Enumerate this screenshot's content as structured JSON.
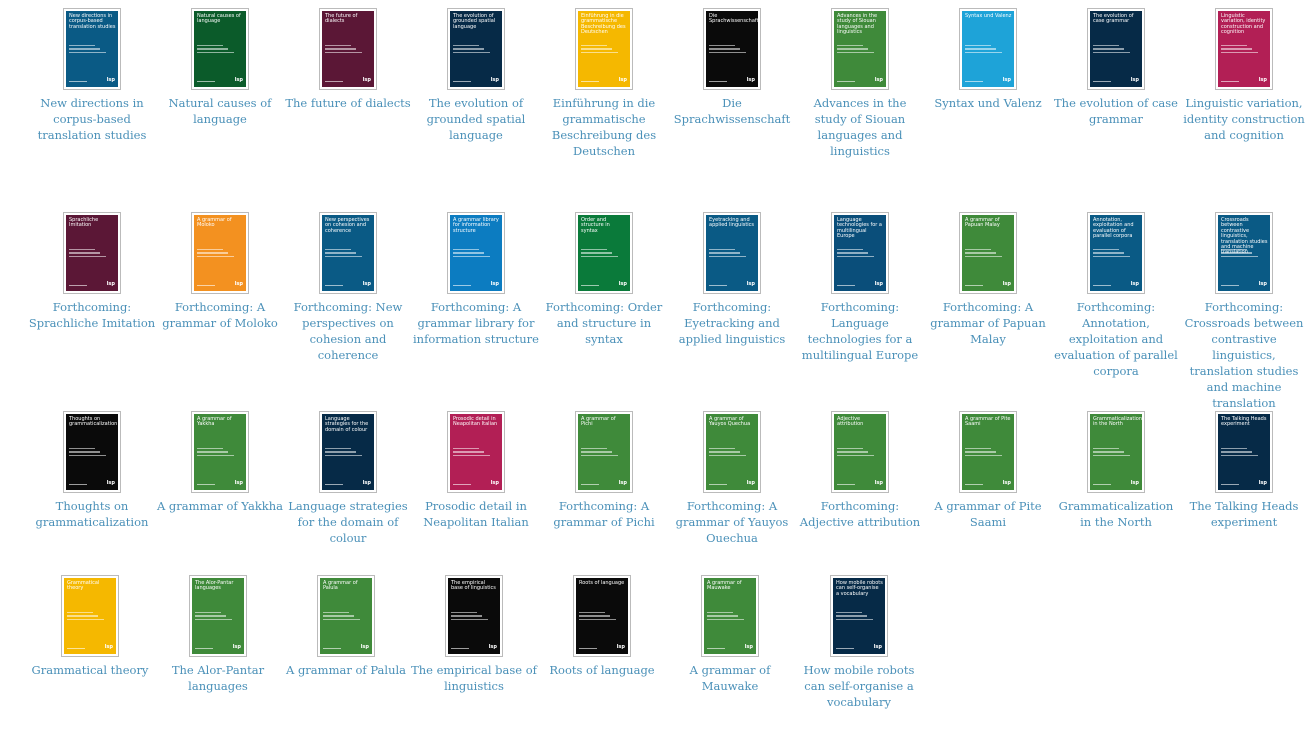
{
  "books": [
    {
      "caption": "New directions in corpus-based translation studies",
      "cover_title": "New directions in corpus-based translation studies",
      "color": "#0a5a85"
    },
    {
      "caption": "Natural causes of language",
      "cover_title": "Natural causes of language",
      "color": "#0b5b2a"
    },
    {
      "caption": "The future of dialects",
      "cover_title": "The future of dialects",
      "color": "#5b1736"
    },
    {
      "caption": "The evolution of grounded spatial language",
      "cover_title": "The evolution of grounded spatial language",
      "color": "#062a47"
    },
    {
      "caption": "Einführung in die grammatische Beschreibung des Deutschen",
      "cover_title": "Einführung in die grammatische Beschreibung des Deutschen",
      "color": "#f5b800"
    },
    {
      "caption": "Die Sprachwissenschaft",
      "cover_title": "Die Sprachwissenschaft",
      "color": "#0a0a0a"
    },
    {
      "caption": "Advances in the study of Siouan languages and linguistics",
      "cover_title": "Advances in the study of Siouan languages and linguistics",
      "color": "#3f8a3a"
    },
    {
      "caption": "Syntax und Valenz",
      "cover_title": "Syntax und Valenz",
      "color": "#1ea3d8"
    },
    {
      "caption": "The evolution of case grammar",
      "cover_title": "The evolution of case grammar",
      "color": "#062a47"
    },
    {
      "caption": "Linguistic variation, identity construction and cognition",
      "cover_title": "Linguistic variation, identity construction and cognition",
      "color": "#b21f55"
    },
    {
      "caption": "Forthcoming: Sprachliche Imitation",
      "cover_title": "Sprachliche Imitation",
      "color": "#5b1736"
    },
    {
      "caption": "Forthcoming: A grammar of Moloko",
      "cover_title": "A grammar of Moloko",
      "color": "#f39120"
    },
    {
      "caption": "Forthcoming: New perspectives on cohesion and coherence",
      "cover_title": "New perspectives on cohesion and coherence",
      "color": "#0a5a85"
    },
    {
      "caption": "Forthcoming: A grammar library for information structure",
      "cover_title": "A grammar library for information structure",
      "color": "#0c7cc1"
    },
    {
      "caption": "Forthcoming: Order and structure in syntax",
      "cover_title": "Order and structure in syntax",
      "color": "#0a7a3a"
    },
    {
      "caption": "Forthcoming: Eyetracking and applied linguistics",
      "cover_title": "Eyetracking and applied linguistics",
      "color": "#0a5a85"
    },
    {
      "caption": "Forthcoming: Language technologies for a multilingual Europe",
      "cover_title": "Language technologies for a multilingual Europe",
      "color": "#0a4e7a"
    },
    {
      "caption": "Forthcoming: A grammar of Papuan Malay",
      "cover_title": "A grammar of Papuan Malay",
      "color": "#3f8a3a"
    },
    {
      "caption": "Forthcoming: Annotation, exploitation and evaluation of parallel corpora",
      "cover_title": "Annotation, exploitation and evaluation of parallel corpora",
      "color": "#0a5a85"
    },
    {
      "caption": "Forthcoming: Crossroads between contrastive linguistics, translation studies and machine translation",
      "cover_title": "Crossroads between contrastive linguistics, translation studies and machine translation",
      "color": "#0a5a85"
    },
    {
      "caption": "Thoughts on grammaticalization",
      "cover_title": "Thoughts on grammaticalization",
      "color": "#0a0a0a"
    },
    {
      "caption": "A grammar of Yakkha",
      "cover_title": "A grammar of Yakkha",
      "color": "#3f8a3a"
    },
    {
      "caption": "Language strategies for the domain of colour",
      "cover_title": "Language strategies for the domain of colour",
      "color": "#062a47"
    },
    {
      "caption": "Prosodic detail in Neapolitan Italian",
      "cover_title": "Prosodic detail in Neapolitan Italian",
      "color": "#b21f55"
    },
    {
      "caption": "Forthcoming: A grammar of Pichi",
      "cover_title": "A grammar of Pichi",
      "color": "#3f8a3a"
    },
    {
      "caption": "Forthcoming: A grammar of Yauyos Ouechua",
      "cover_title": "A grammar of Yauyos Quechua",
      "color": "#3f8a3a"
    },
    {
      "caption": "Forthcoming: Adjective attribution",
      "cover_title": "Adjective attribution",
      "color": "#3f8a3a"
    },
    {
      "caption": "A grammar of Pite Saami",
      "cover_title": "A grammar of Pite Saami",
      "color": "#3f8a3a"
    },
    {
      "caption": "Grammaticalization in the North",
      "cover_title": "Grammaticalization in the North",
      "color": "#3f8a3a"
    },
    {
      "caption": "The Talking Heads experiment",
      "cover_title": "The Talking Heads experiment",
      "color": "#062a47"
    },
    {
      "caption": "Grammatical theory",
      "cover_title": "Grammatical theory",
      "color": "#f5b800"
    },
    {
      "caption": "The Alor-Pantar languages",
      "cover_title": "The Alor-Pantar languages",
      "color": "#3f8a3a"
    },
    {
      "caption": "A grammar of Palula",
      "cover_title": "A grammar of Palula",
      "color": "#3f8a3a"
    },
    {
      "caption": "The empirical base of linguistics",
      "cover_title": "The empirical base of linguistics",
      "color": "#0a0a0a"
    },
    {
      "caption": "Roots of language",
      "cover_title": "Roots of language",
      "color": "#0a0a0a"
    },
    {
      "caption": "A grammar of Mauwake",
      "cover_title": "A grammar of Mauwake",
      "color": "#3f8a3a"
    },
    {
      "caption": "How mobile robots can self-organise a vocabulary",
      "cover_title": "How mobile robots can self-organise a vocabulary",
      "color": "#062a47"
    }
  ],
  "logo_text": "lsp"
}
